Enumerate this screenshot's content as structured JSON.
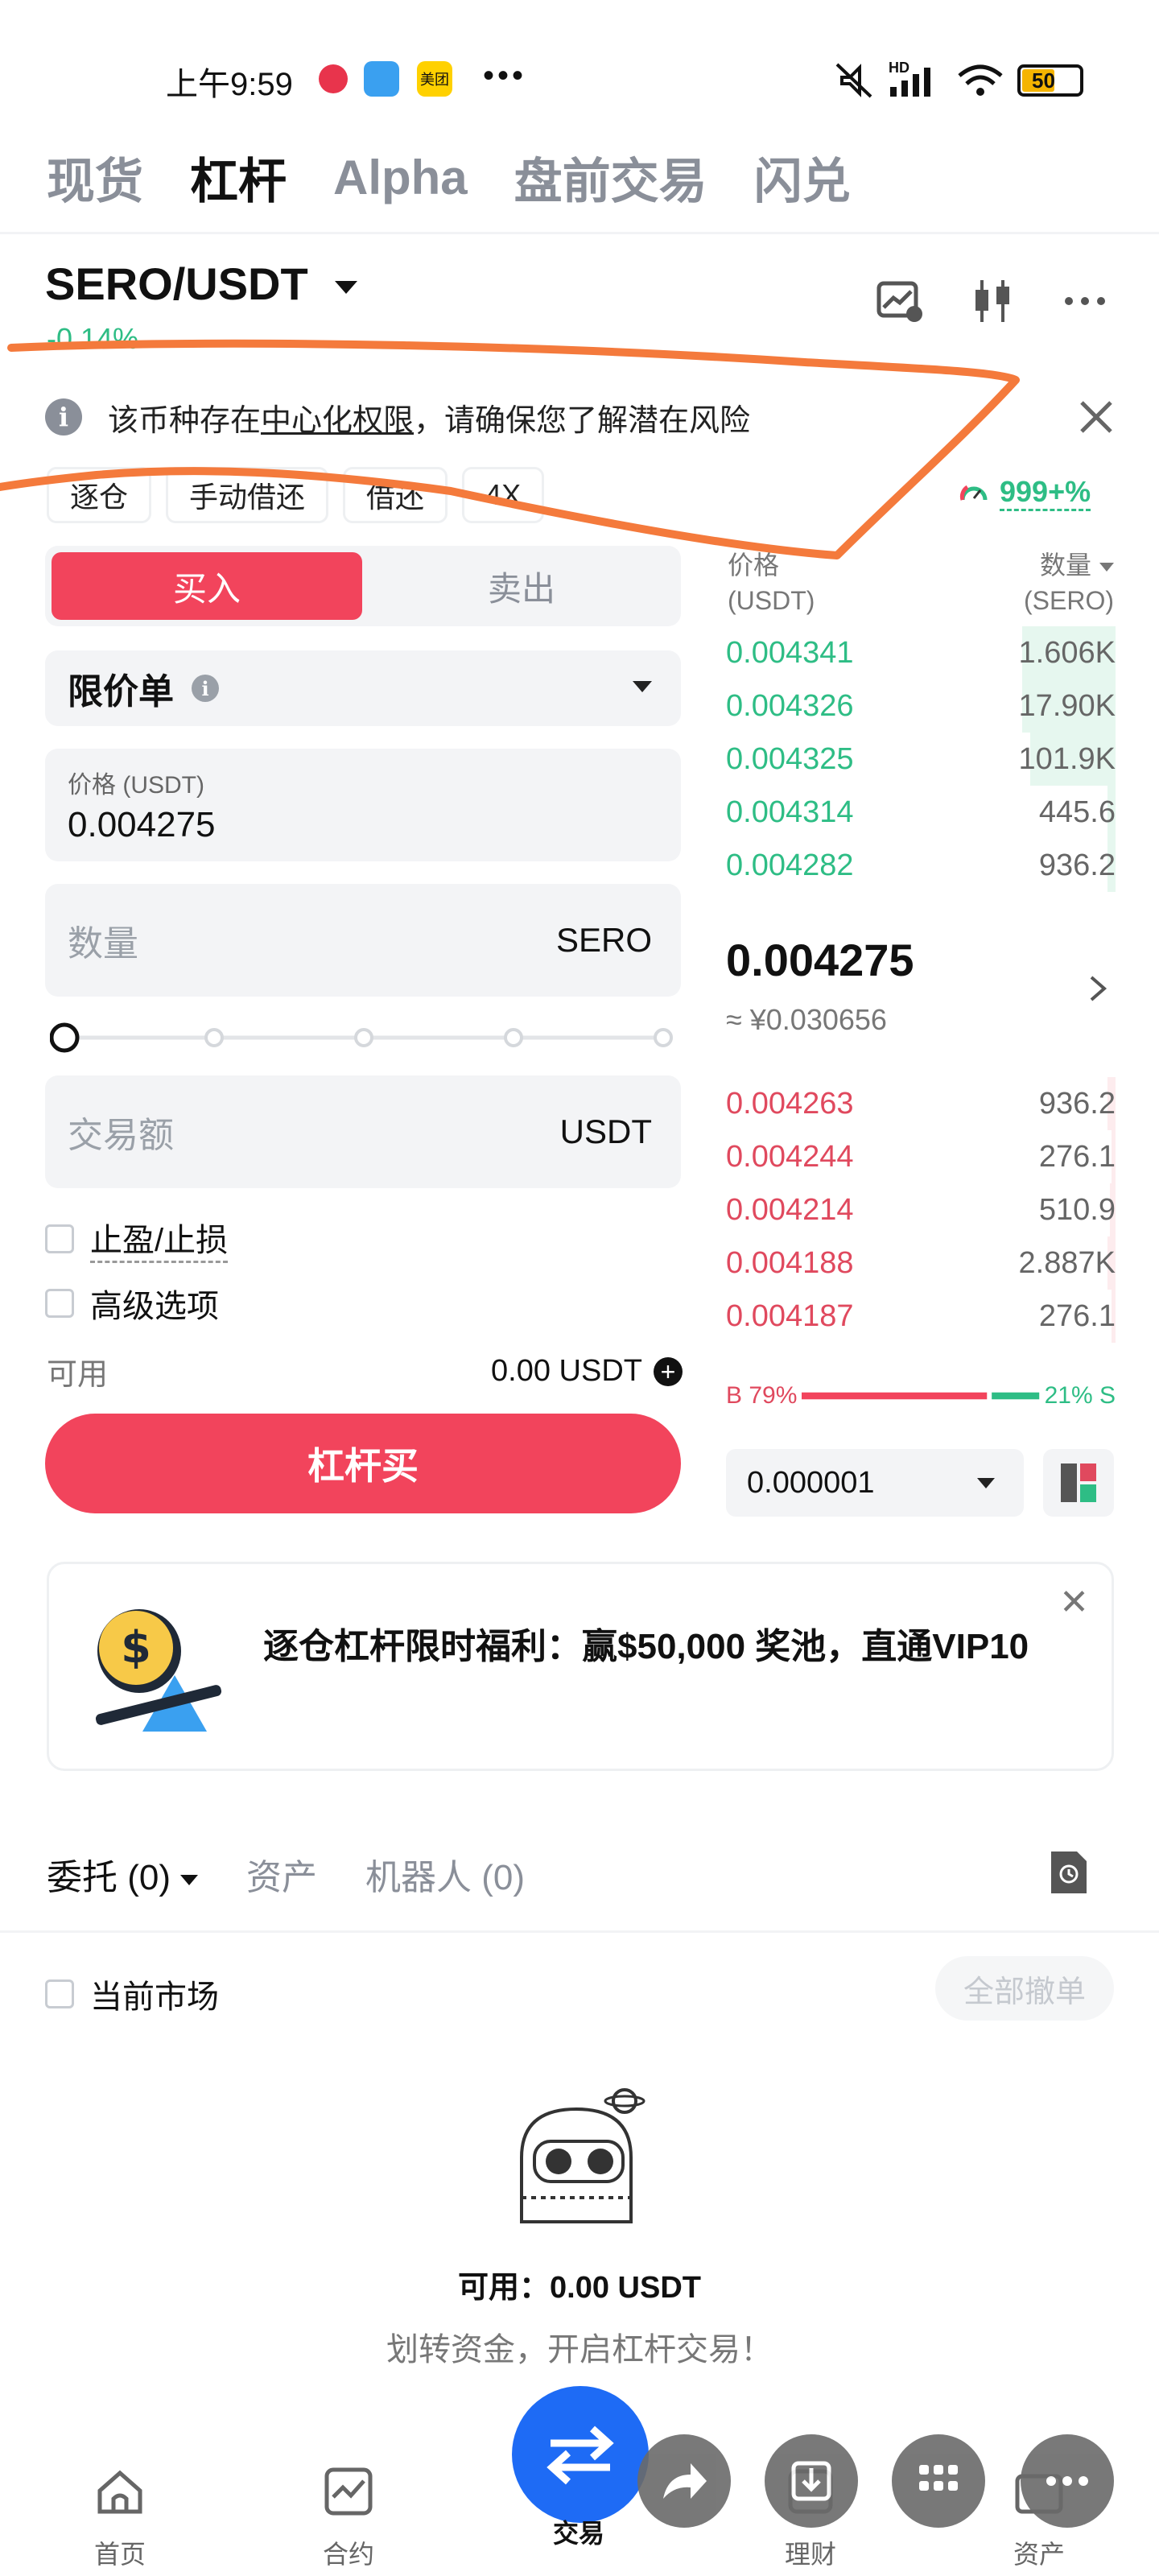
{
  "status": {
    "time": "上午9:59",
    "app_badge": "美团",
    "network": "HD",
    "battery": "50"
  },
  "tabs": [
    "现货",
    "杠杆",
    "Alpha",
    "盘前交易",
    "闪兑"
  ],
  "pair": {
    "name": "SERO/USDT",
    "change": "-0.14%"
  },
  "notice": {
    "prefix": "该币种存在",
    "link": "中心化权限",
    "suffix": "，请确保您了解潜在风险"
  },
  "chips": [
    "逐仓",
    "手动借还",
    "借还",
    "4X"
  ],
  "risk_rate": "999+%",
  "trade": {
    "buy_label": "买入",
    "sell_label": "卖出",
    "order_type": "限价单",
    "price_label": "价格 (USDT)",
    "price_value": "0.004275",
    "qty_placeholder": "数量",
    "qty_unit": "SERO",
    "amount_placeholder": "交易额",
    "amount_unit": "USDT",
    "tpsl_label": "止盈/止损",
    "advanced_label": "高级选项",
    "available_label": "可用",
    "available_value": "0.00 USDT",
    "submit_label": "杠杆买"
  },
  "orderbook": {
    "price_header": "价格",
    "price_unit": "(USDT)",
    "qty_header": "数量",
    "qty_unit": "(SERO)",
    "asks": [
      {
        "price": "0.004341",
        "qty": "1.606K",
        "depth": 0.24
      },
      {
        "price": "0.004326",
        "qty": "17.90K",
        "depth": 0.24
      },
      {
        "price": "0.004325",
        "qty": "101.9K",
        "depth": 0.22
      },
      {
        "price": "0.004314",
        "qty": "445.6",
        "depth": 0.02
      },
      {
        "price": "0.004282",
        "qty": "936.2",
        "depth": 0.02
      }
    ],
    "last_price": "0.004275",
    "last_price_cny": "≈ ¥0.030656",
    "bids": [
      {
        "price": "0.004263",
        "qty": "936.2",
        "depth": 0.02
      },
      {
        "price": "0.004244",
        "qty": "276.1",
        "depth": 0.01
      },
      {
        "price": "0.004214",
        "qty": "510.9",
        "depth": 0.015
      },
      {
        "price": "0.004188",
        "qty": "2.887K",
        "depth": 0.02
      },
      {
        "price": "0.004187",
        "qty": "276.1",
        "depth": 0.01
      }
    ],
    "buy_ratio_label": "B 79%",
    "sell_ratio_label": "21% S",
    "buy_ratio": 0.79,
    "precision": "0.000001"
  },
  "promo": {
    "text": "逐仓杠杆限时福利：赢$50,000 奖池，直通VIP10"
  },
  "orders": {
    "tab_orders": "委托 (0)",
    "tab_assets": "资产",
    "tab_bots": "机器人 (0)",
    "current_market": "当前市场",
    "cancel_all": "全部撤单",
    "empty_available": "可用：0.00 USDT",
    "empty_hint": "划转资金，开启杠杆交易！"
  },
  "nav": [
    "首页",
    "合约",
    "交易",
    "理财",
    "资产"
  ],
  "colors": {
    "buy": "#f2445c",
    "ask_green": "#2ebd85",
    "bid_red": "#e0495e",
    "fab_blue": "#1e6bf5",
    "annotation_orange": "#f47a3c"
  }
}
